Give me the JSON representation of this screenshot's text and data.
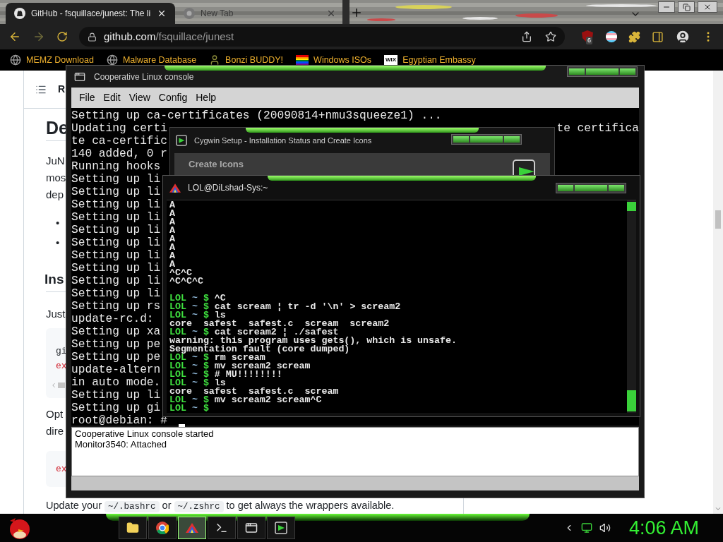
{
  "browser": {
    "tabs": [
      {
        "title": "GitHub - fsquillace/junest: The li",
        "kind": "github",
        "selected": true
      },
      {
        "title": "New Tab",
        "kind": "newtab",
        "selected": false
      }
    ],
    "address": {
      "host": "github.com",
      "path": "/fsquillace/junest"
    },
    "extension_badge": "6",
    "bookmarks": [
      {
        "label": "MEMZ Download",
        "kind": "globe"
      },
      {
        "label": "Malware Database",
        "kind": "globe"
      },
      {
        "label": "Bonzi BUDDY!",
        "kind": "figure"
      },
      {
        "label": "Windows ISOs",
        "kind": "rainbow"
      },
      {
        "label": "Egyptian Embassy",
        "kind": "badge",
        "badge_text": "WIX"
      }
    ]
  },
  "page": {
    "toc_label": "R",
    "heading_1": "De",
    "paragraph_lines": [
      "JuN",
      "mos",
      "dep"
    ],
    "bullets": [
      "•",
      "•"
    ],
    "heading_2": "Ins",
    "text_1": "Just",
    "code_1": [
      {
        "text": "gi",
        "kind": "plain"
      },
      {
        "text": "ex",
        "kind": "keyword"
      }
    ],
    "text_2": [
      "Opt",
      "dire"
    ],
    "code_2": [
      {
        "text": "ex",
        "kind": "keyword"
      }
    ],
    "footer": [
      {
        "text": "Update your ",
        "kind": "text"
      },
      {
        "text": "~/.bashrc",
        "kind": "code"
      },
      {
        "text": " or ",
        "kind": "text"
      },
      {
        "text": "~/.zshrc",
        "kind": "code"
      },
      {
        "text": " to get always the wrappers available.",
        "kind": "text"
      }
    ]
  },
  "console": {
    "title": "Cooperative Linux console",
    "menu": [
      "File",
      "Edit",
      "View",
      "Config",
      "Help"
    ],
    "lines": [
      {
        "text": "Setting up ca-certificates (20090814+nmu3squeeze1) ..."
      },
      {
        "text": "Updating certi",
        "right": "te certifica"
      },
      {
        "text": "te ca-certific"
      },
      {
        "text": "140 added, 0 r"
      },
      {
        "text": "Running hooks"
      },
      {
        "text": "Setting up li"
      },
      {
        "text": "Setting up li"
      },
      {
        "text": "Setting up li"
      },
      {
        "text": "Setting up li"
      },
      {
        "text": "Setting up li"
      },
      {
        "text": "Setting up li"
      },
      {
        "text": "Setting up li"
      },
      {
        "text": "Setting up li"
      },
      {
        "text": "Setting up li"
      },
      {
        "text": "Setting up li"
      },
      {
        "text": "Setting up rs"
      },
      {
        "text": "update-rc.d:"
      },
      {
        "text": "Setting up xa"
      },
      {
        "text": "Setting up pe"
      },
      {
        "text": "Setting up pe"
      },
      {
        "text": "update-altern"
      },
      {
        "text": "in auto mode."
      },
      {
        "text": "Setting up li"
      },
      {
        "text": "Setting up gi"
      },
      {
        "text": "root@debian: #",
        "cursor": true
      }
    ],
    "log": [
      "Cooperative Linux console started",
      "Monitor3540: Attached"
    ]
  },
  "cygwin": {
    "title": "Cygwin Setup - Installation Status and Create Icons",
    "header": "Create Icons"
  },
  "terminal": {
    "title": "LOL@DiLshad-Sys:~",
    "lines": [
      {
        "kind": "output",
        "text": "A"
      },
      {
        "kind": "output",
        "text": "A"
      },
      {
        "kind": "output",
        "text": "A"
      },
      {
        "kind": "output",
        "text": "A"
      },
      {
        "kind": "output",
        "text": "A"
      },
      {
        "kind": "output",
        "text": "A"
      },
      {
        "kind": "output",
        "text": "A"
      },
      {
        "kind": "output",
        "text": "A"
      },
      {
        "kind": "output",
        "text": "^C^C"
      },
      {
        "kind": "output",
        "text": "^C^C^C"
      },
      {
        "kind": "blank"
      },
      {
        "kind": "prompt",
        "user": "LOL",
        "dir": "~",
        "symbol": "$",
        "command": "^C"
      },
      {
        "kind": "prompt",
        "user": "LOL",
        "dir": "~",
        "symbol": "$",
        "command": "cat scream ¦ tr -d '\\n' > scream2"
      },
      {
        "kind": "prompt",
        "user": "LOL",
        "dir": "~",
        "symbol": "$",
        "command": "ls"
      },
      {
        "kind": "output",
        "text": "core  safest  safest.c  scream  scream2"
      },
      {
        "kind": "prompt",
        "user": "LOL",
        "dir": "~",
        "symbol": "$",
        "command": "cat scream2 ¦ ./safest"
      },
      {
        "kind": "output",
        "text": "warning: this program uses gets(), which is unsafe."
      },
      {
        "kind": "output",
        "text": "Segmentation fault (core dumped)"
      },
      {
        "kind": "prompt",
        "user": "LOL",
        "dir": "~",
        "symbol": "$",
        "command": "rm scream"
      },
      {
        "kind": "prompt",
        "user": "LOL",
        "dir": "~",
        "symbol": "$",
        "command": "mv scream2 scream"
      },
      {
        "kind": "prompt",
        "user": "LOL",
        "dir": "~",
        "symbol": "$",
        "command": "# MU!!!!!!!!"
      },
      {
        "kind": "prompt",
        "user": "LOL",
        "dir": "~",
        "symbol": "$",
        "command": "ls"
      },
      {
        "kind": "output",
        "text": "core  safest  safest.c  scream"
      },
      {
        "kind": "prompt",
        "user": "LOL",
        "dir": "~",
        "symbol": "$",
        "command": "mv scream2 scream^C"
      },
      {
        "kind": "prompt",
        "user": "LOL",
        "dir": "~",
        "symbol": "$"
      }
    ]
  },
  "taskbar": {
    "apps": [
      {
        "kind": "folder",
        "selected": false
      },
      {
        "kind": "browser",
        "selected": false
      },
      {
        "kind": "triangle",
        "selected": true
      },
      {
        "kind": "cmd",
        "selected": false
      },
      {
        "kind": "window",
        "selected": false
      },
      {
        "kind": "cygwin",
        "selected": false
      }
    ],
    "clock": "4:06 AM"
  }
}
